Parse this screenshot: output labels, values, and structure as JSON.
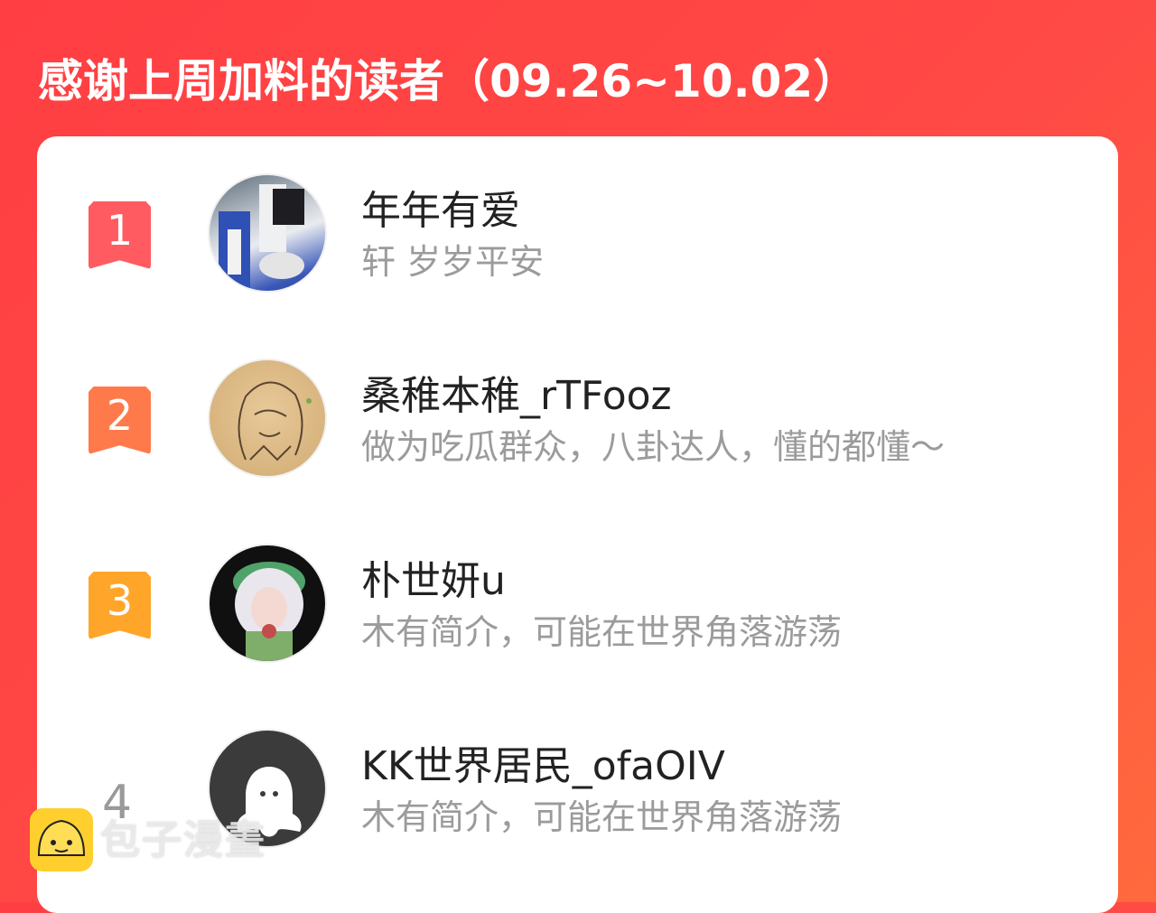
{
  "header": {
    "title": "感谢上周加料的读者（09.26~10.02）"
  },
  "readers": [
    {
      "rank": "1",
      "name": "年年有爱",
      "desc": "轩 岁岁平安",
      "badge_color": "#ff5b60",
      "avatar": "photo-avatar"
    },
    {
      "rank": "2",
      "name": "桑稚本稚_rTFooz",
      "desc": "做为吃瓜群众，八卦达人，懂的都懂～",
      "badge_color": "#ff7a4a",
      "avatar": "sketch-avatar"
    },
    {
      "rank": "3",
      "name": "朴世妍u",
      "desc": "木有简介，可能在世界角落游荡",
      "badge_color": "#ffa62a",
      "avatar": "photo-avatar"
    },
    {
      "rank": "4",
      "name": "KK世界居民_ofaOIV",
      "desc": "木有简介，可能在世界角落游荡",
      "avatar": "default-avatar"
    }
  ],
  "watermark": {
    "text": "包子漫畫",
    "icon": "bun-icon"
  },
  "colors": {
    "accent": "#ff4444",
    "card": "#ffffff",
    "desc_text": "#9b9b9b"
  }
}
